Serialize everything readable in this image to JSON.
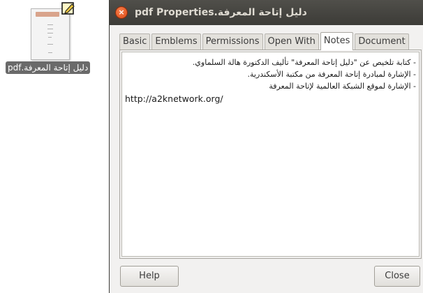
{
  "desktop": {
    "file_label": "دليل إتاحة المعرفة.pdf"
  },
  "window": {
    "title": "دليل إتاحة المعرفة.pdf Properties",
    "close_glyph": "×"
  },
  "tabs": [
    {
      "label": "Basic",
      "active": false
    },
    {
      "label": "Emblems",
      "active": false
    },
    {
      "label": "Permissions",
      "active": false
    },
    {
      "label": "Open With",
      "active": false
    },
    {
      "label": "Notes",
      "active": true
    },
    {
      "label": "Document",
      "active": false
    }
  ],
  "notes": {
    "lines": [
      "- كتابة تلخيص عن \"دليل إتاحة المعرفة\" تأليف الدكتورة هالة السلماوي.",
      "- الإشارة لمبادرة إتاحة المعرفة من مكتبة الأسكندرية.",
      "- الإشارة لموقع الشبكة العالمية لإتاحة المعرفة"
    ],
    "url": "http://a2knetwork.org/"
  },
  "buttons": {
    "help": "Help",
    "close": "Close"
  },
  "colors": {
    "titlebar": "#3c3b37",
    "close_button": "#df4a16",
    "window_bg": "#f2f1f0"
  }
}
